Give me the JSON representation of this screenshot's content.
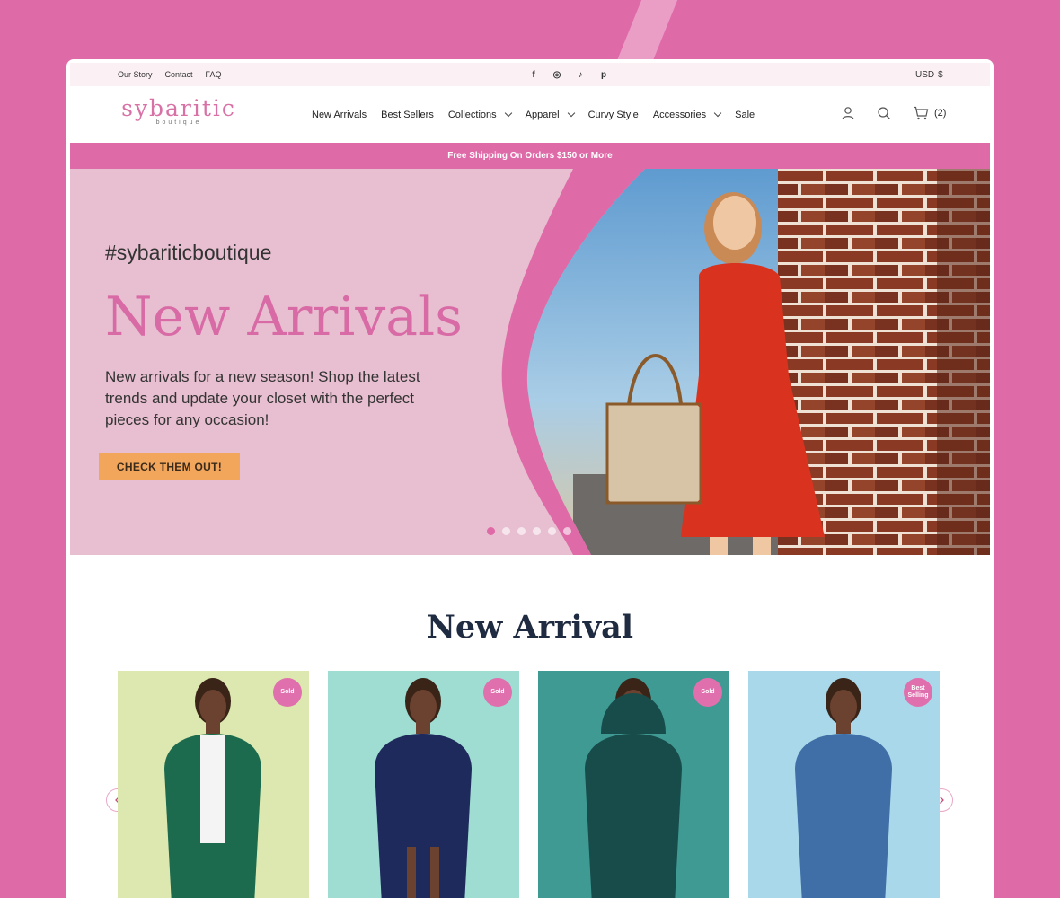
{
  "util": {
    "links": [
      "Our Story",
      "Contact",
      "FAQ"
    ],
    "socials": [
      {
        "icon": "facebook-icon",
        "glyph": "f"
      },
      {
        "icon": "instagram-icon",
        "glyph": "◎"
      },
      {
        "icon": "tiktok-icon",
        "glyph": "♪"
      },
      {
        "icon": "pinterest-icon",
        "glyph": "p"
      }
    ],
    "currency": "USD",
    "currency_symbol": "$"
  },
  "brand": {
    "name": "sybaritic",
    "sub": "boutique"
  },
  "nav": {
    "items": [
      {
        "label": "New Arrivals",
        "dropdown": false
      },
      {
        "label": "Best Sellers",
        "dropdown": false
      },
      {
        "label": "Collections",
        "dropdown": true
      },
      {
        "label": "Apparel",
        "dropdown": true
      },
      {
        "label": "Curvy Style",
        "dropdown": false
      },
      {
        "label": "Accessories",
        "dropdown": true
      },
      {
        "label": "Sale",
        "dropdown": false
      }
    ],
    "cart_count": "(2)"
  },
  "promo": "Free Shipping On Orders $150 or More",
  "hero": {
    "hashtag": "#sybariticboutique",
    "title": "New Arrivals",
    "description": "New arrivals for a new season! Shop the latest trends and update your closet with the perfect pieces for any occasion!",
    "cta": "CHECK THEM OUT!",
    "slides_total": 6,
    "active_slide": 1
  },
  "section": {
    "title": "New Arrival",
    "products": [
      {
        "badge": "Sold",
        "bg": "#dce8b0",
        "garment": "#1d6b4f",
        "style": "cardigan"
      },
      {
        "badge": "Sold",
        "bg": "#9fdcd2",
        "garment": "#1e2a5c",
        "style": "dress"
      },
      {
        "badge": "Sold",
        "bg": "#3f9a93",
        "garment": "#184c4a",
        "style": "hoodie"
      },
      {
        "badge": "Best Selling",
        "bg": "#a9d8ea",
        "garment": "#3f6fa6",
        "style": "denim"
      }
    ]
  },
  "colors": {
    "accent": "#df6aa8",
    "button": "#f2a65b",
    "hero_bg": "#e8bfd0"
  }
}
